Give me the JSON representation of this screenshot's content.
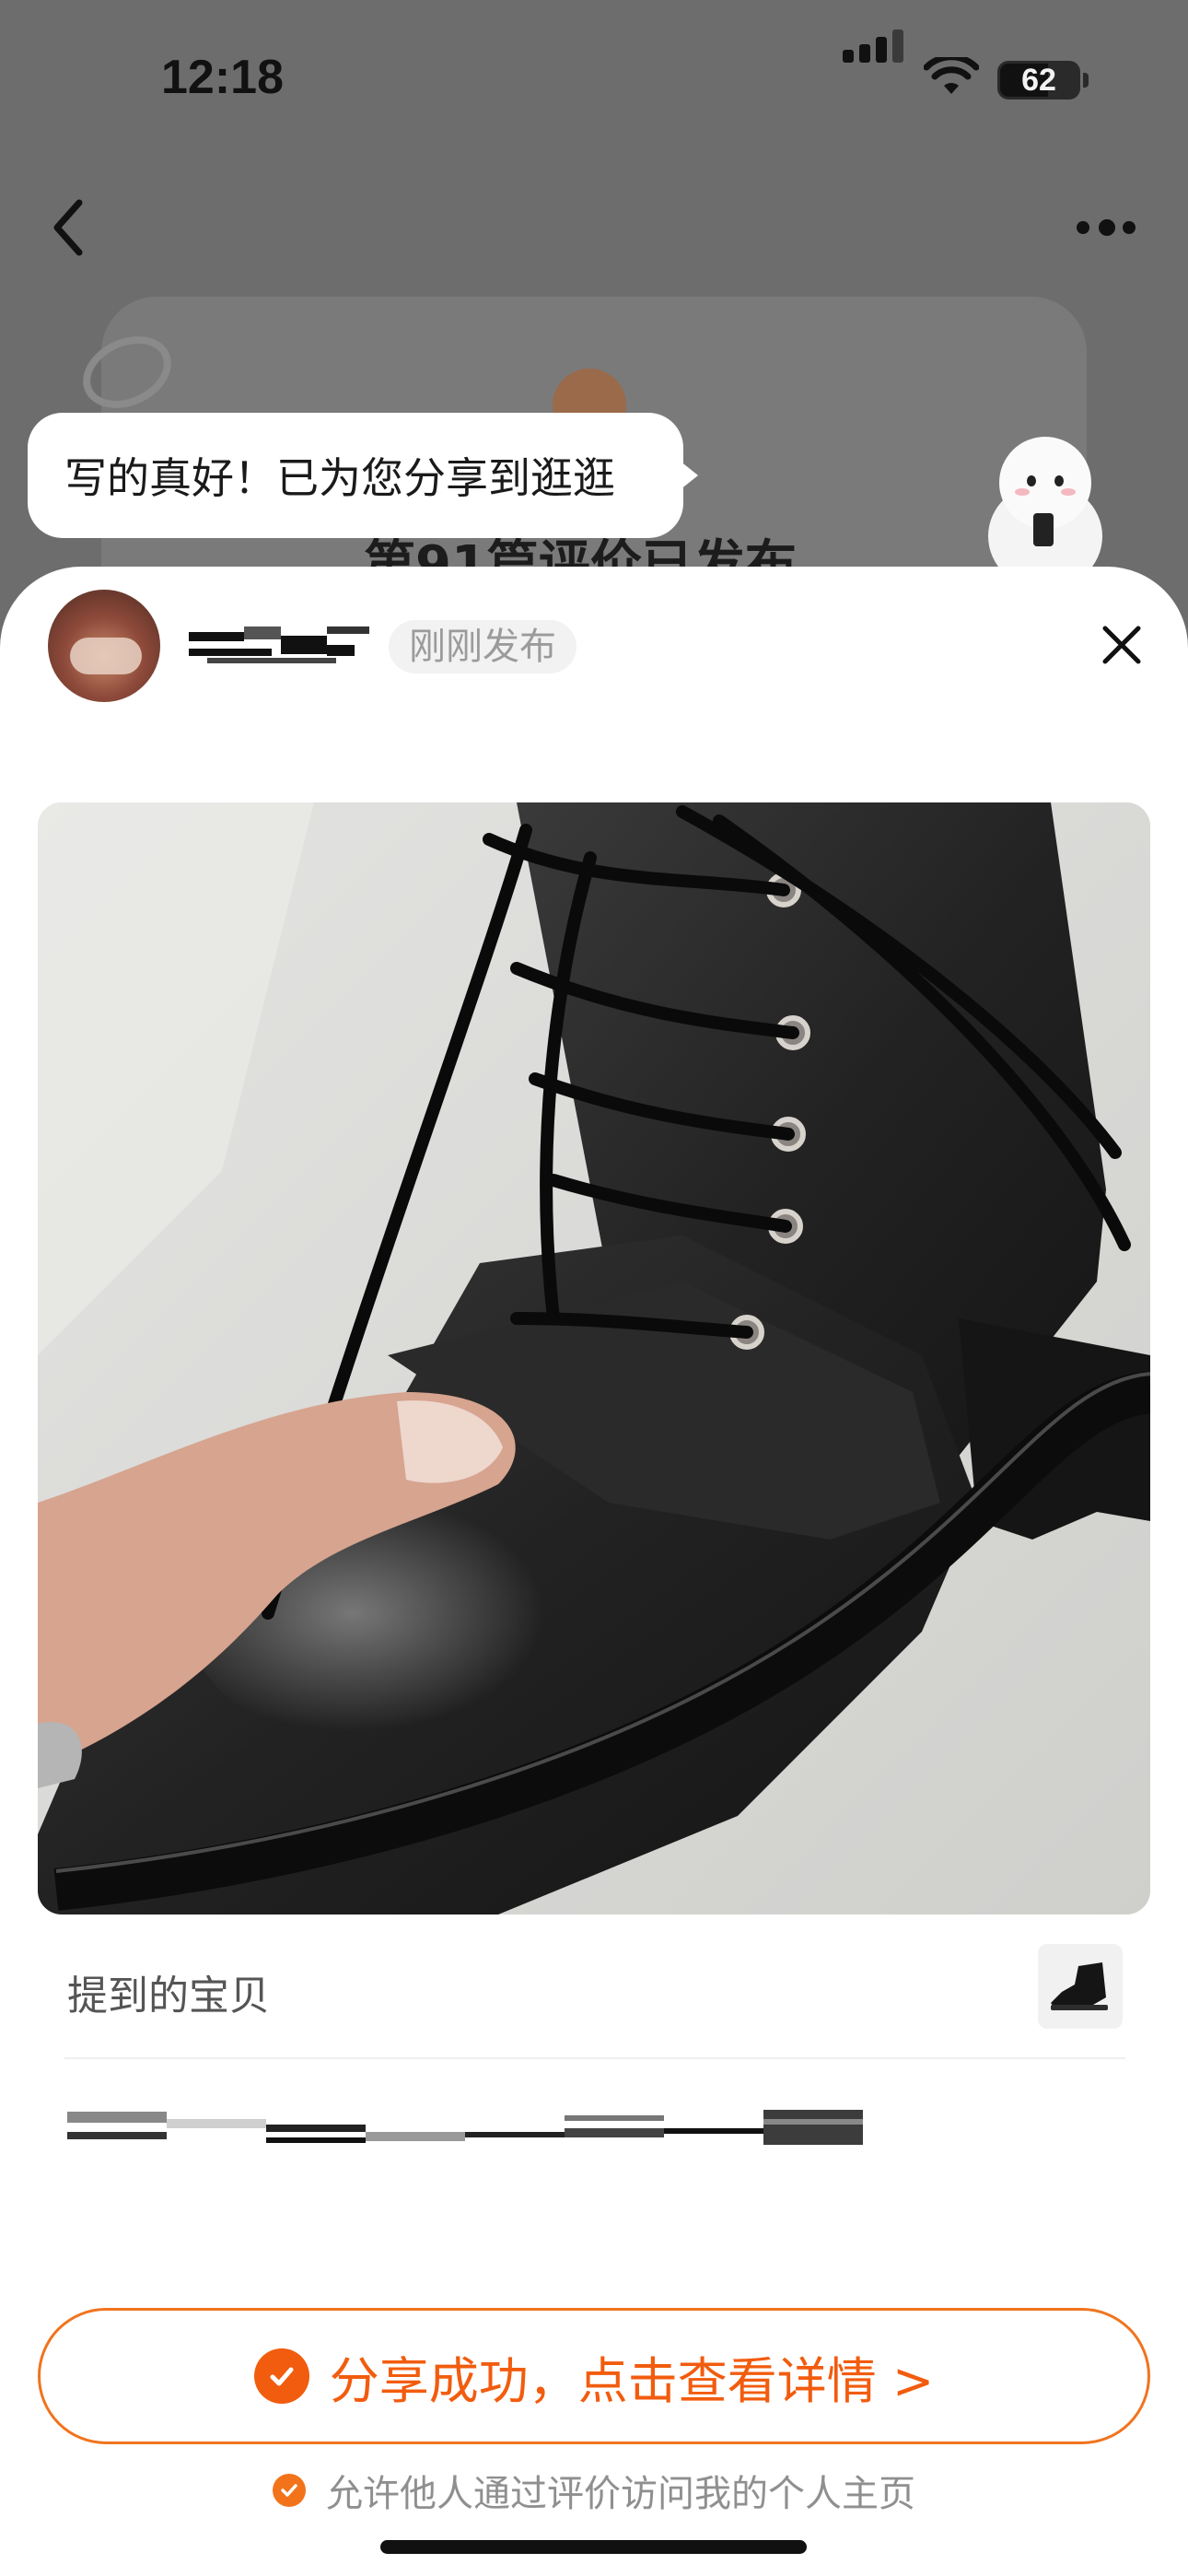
{
  "status_bar": {
    "time": "12:18",
    "battery_level": "62",
    "battery_fill_fraction": 0.62
  },
  "background_page": {
    "headline": "第91篇评价已发布"
  },
  "toast": {
    "text": "写的真好！已为您分享到逛逛"
  },
  "post": {
    "time_badge": "刚刚发布",
    "photo_icon": "boot-photo",
    "mentioned_label": "提到的宝贝",
    "mentioned_thumb_icon": "boot-thumbnail"
  },
  "actions": {
    "cta_label": "分享成功，点击查看详情 >",
    "permission_label": "允许他人通过评价访问我的个人主页"
  },
  "colors": {
    "accent": "#f25c0e",
    "cta_border": "#f0741e",
    "dim_overlay": "#6d6d6d",
    "muted_text": "#8f8f8f"
  },
  "icons": {
    "nav_back": "chevron-left-icon",
    "nav_more": "more-dots-icon",
    "close": "close-icon",
    "check": "check-circle-icon"
  }
}
